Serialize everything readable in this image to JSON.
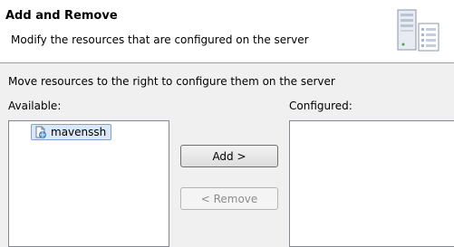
{
  "header": {
    "title": "Add and Remove",
    "description": "Modify the resources that are configured on the server",
    "icon": "server-banner-icon"
  },
  "instruction": "Move resources to the right to configure them on the server",
  "available": {
    "label": "Available:",
    "items": [
      {
        "label": "mavenssh",
        "icon": "web-project-icon",
        "selected": true
      }
    ]
  },
  "configured": {
    "label": "Configured:",
    "items": []
  },
  "buttons": {
    "add": "Add >",
    "remove": "< Remove",
    "remove_enabled": false
  },
  "colors": {
    "selection_fill": "#dbe7f6",
    "selection_border": "#7da2ce",
    "disabled_text": "#8d8d8d"
  }
}
